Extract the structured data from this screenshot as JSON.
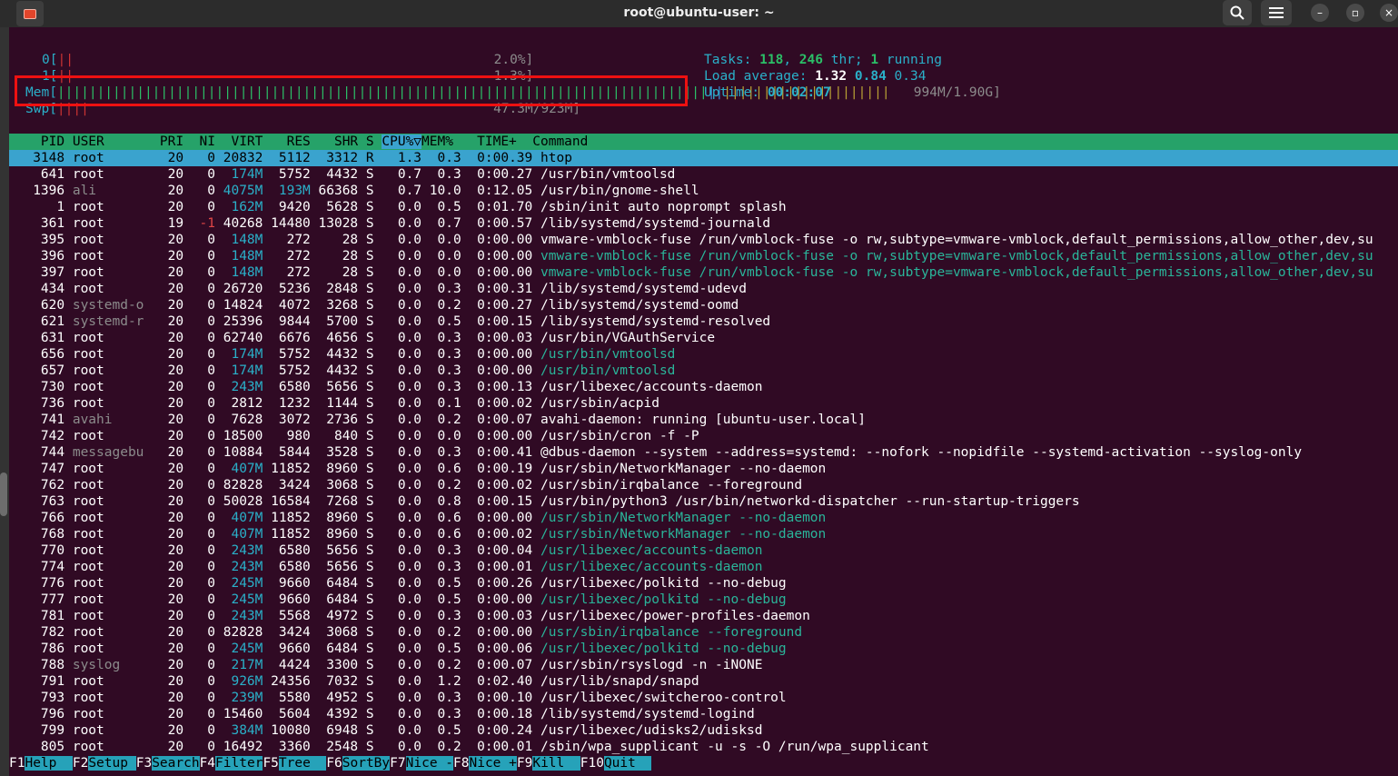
{
  "window": {
    "title": "root@ubuntu-user: ~"
  },
  "meters": {
    "cpu0": {
      "label": "0[",
      "value": "2.0%]"
    },
    "cpu1": {
      "label": "1[",
      "value": "1.3%]"
    },
    "mem": {
      "label": "Mem[",
      "value": "994M/1.90G]"
    },
    "swp": {
      "label": "Swp[",
      "value": "47.3M/923M]"
    }
  },
  "stats": {
    "tasks_label": "Tasks: ",
    "tasks": "118",
    "thr_label": ", ",
    "thr": "246",
    "thr_suffix": " thr; ",
    "running": "1",
    "running_suffix": " running",
    "load_label": "Load average: ",
    "load1": "1.32",
    "load5": "0.84",
    "load15": "0.34",
    "uptime_label": "Uptime: ",
    "uptime": "00:02:07"
  },
  "table": {
    "headers": {
      "pid": "  PID",
      "user": "USER",
      "pri": "PRI",
      "ni": "NI",
      "virt": " VIRT",
      "res": "  RES",
      "shr": "  SHR",
      "s": "S",
      "cpu": "CPU%▽",
      "mem": "MEM%",
      "time": "  TIME+",
      "cmd": "Command"
    },
    "rows": [
      [
        "3148",
        "root",
        "20",
        "0",
        "20832",
        "5112",
        "3312",
        "R",
        "1.3",
        "0.3",
        "0:00.39",
        "htop"
      ],
      [
        "641",
        "root",
        "20",
        "0",
        "174M",
        "5752",
        "4432",
        "S",
        "0.7",
        "0.3",
        "0:00.27",
        "/usr/bin/vmtoolsd"
      ],
      [
        "1396",
        "ali",
        "20",
        "0",
        "4075M",
        "193M",
        "66368",
        "S",
        "0.7",
        "10.0",
        "0:12.05",
        "/usr/bin/gnome-shell"
      ],
      [
        "1",
        "root",
        "20",
        "0",
        "162M",
        "9420",
        "5628",
        "S",
        "0.0",
        "0.5",
        "0:01.70",
        "/sbin/init auto noprompt splash"
      ],
      [
        "361",
        "root",
        "19",
        "-1",
        "40268",
        "14480",
        "13028",
        "S",
        "0.0",
        "0.7",
        "0:00.57",
        "/lib/systemd/systemd-journald"
      ],
      [
        "395",
        "root",
        "20",
        "0",
        "148M",
        "272",
        "28",
        "S",
        "0.0",
        "0.0",
        "0:00.00",
        "vmware-vmblock-fuse /run/vmblock-fuse -o rw,subtype=vmware-vmblock,default_permissions,allow_other,dev,su"
      ],
      [
        "396",
        "root",
        "20",
        "0",
        "148M",
        "272",
        "28",
        "S",
        "0.0",
        "0.0",
        "0:00.00",
        "vmware-vmblock-fuse /run/vmblock-fuse -o rw,subtype=vmware-vmblock,default_permissions,allow_other,dev,su"
      ],
      [
        "397",
        "root",
        "20",
        "0",
        "148M",
        "272",
        "28",
        "S",
        "0.0",
        "0.0",
        "0:00.00",
        "vmware-vmblock-fuse /run/vmblock-fuse -o rw,subtype=vmware-vmblock,default_permissions,allow_other,dev,su"
      ],
      [
        "434",
        "root",
        "20",
        "0",
        "26720",
        "5236",
        "2848",
        "S",
        "0.0",
        "0.3",
        "0:00.31",
        "/lib/systemd/systemd-udevd"
      ],
      [
        "620",
        "systemd-o",
        "20",
        "0",
        "14824",
        "4072",
        "3268",
        "S",
        "0.0",
        "0.2",
        "0:00.27",
        "/lib/systemd/systemd-oomd"
      ],
      [
        "621",
        "systemd-r",
        "20",
        "0",
        "25396",
        "9844",
        "5700",
        "S",
        "0.0",
        "0.5",
        "0:00.15",
        "/lib/systemd/systemd-resolved"
      ],
      [
        "631",
        "root",
        "20",
        "0",
        "62740",
        "6676",
        "4656",
        "S",
        "0.0",
        "0.3",
        "0:00.03",
        "/usr/bin/VGAuthService"
      ],
      [
        "656",
        "root",
        "20",
        "0",
        "174M",
        "5752",
        "4432",
        "S",
        "0.0",
        "0.3",
        "0:00.00",
        "/usr/bin/vmtoolsd"
      ],
      [
        "657",
        "root",
        "20",
        "0",
        "174M",
        "5752",
        "4432",
        "S",
        "0.0",
        "0.3",
        "0:00.00",
        "/usr/bin/vmtoolsd"
      ],
      [
        "730",
        "root",
        "20",
        "0",
        "243M",
        "6580",
        "5656",
        "S",
        "0.0",
        "0.3",
        "0:00.13",
        "/usr/libexec/accounts-daemon"
      ],
      [
        "736",
        "root",
        "20",
        "0",
        "2812",
        "1232",
        "1144",
        "S",
        "0.0",
        "0.1",
        "0:00.02",
        "/usr/sbin/acpid"
      ],
      [
        "741",
        "avahi",
        "20",
        "0",
        "7628",
        "3072",
        "2736",
        "S",
        "0.0",
        "0.2",
        "0:00.07",
        "avahi-daemon: running [ubuntu-user.local]"
      ],
      [
        "742",
        "root",
        "20",
        "0",
        "18500",
        "980",
        "840",
        "S",
        "0.0",
        "0.0",
        "0:00.00",
        "/usr/sbin/cron -f -P"
      ],
      [
        "744",
        "messagebu",
        "20",
        "0",
        "10884",
        "5844",
        "3528",
        "S",
        "0.0",
        "0.3",
        "0:00.41",
        "@dbus-daemon --system --address=systemd: --nofork --nopidfile --systemd-activation --syslog-only"
      ],
      [
        "747",
        "root",
        "20",
        "0",
        "407M",
        "11852",
        "8960",
        "S",
        "0.0",
        "0.6",
        "0:00.19",
        "/usr/sbin/NetworkManager --no-daemon"
      ],
      [
        "762",
        "root",
        "20",
        "0",
        "82828",
        "3424",
        "3068",
        "S",
        "0.0",
        "0.2",
        "0:00.02",
        "/usr/sbin/irqbalance --foreground"
      ],
      [
        "763",
        "root",
        "20",
        "0",
        "50028",
        "16584",
        "7268",
        "S",
        "0.0",
        "0.8",
        "0:00.15",
        "/usr/bin/python3 /usr/bin/networkd-dispatcher --run-startup-triggers"
      ],
      [
        "766",
        "root",
        "20",
        "0",
        "407M",
        "11852",
        "8960",
        "S",
        "0.0",
        "0.6",
        "0:00.00",
        "/usr/sbin/NetworkManager --no-daemon"
      ],
      [
        "768",
        "root",
        "20",
        "0",
        "407M",
        "11852",
        "8960",
        "S",
        "0.0",
        "0.6",
        "0:00.02",
        "/usr/sbin/NetworkManager --no-daemon"
      ],
      [
        "770",
        "root",
        "20",
        "0",
        "243M",
        "6580",
        "5656",
        "S",
        "0.0",
        "0.3",
        "0:00.04",
        "/usr/libexec/accounts-daemon"
      ],
      [
        "774",
        "root",
        "20",
        "0",
        "243M",
        "6580",
        "5656",
        "S",
        "0.0",
        "0.3",
        "0:00.01",
        "/usr/libexec/accounts-daemon"
      ],
      [
        "776",
        "root",
        "20",
        "0",
        "245M",
        "9660",
        "6484",
        "S",
        "0.0",
        "0.5",
        "0:00.26",
        "/usr/libexec/polkitd --no-debug"
      ],
      [
        "777",
        "root",
        "20",
        "0",
        "245M",
        "9660",
        "6484",
        "S",
        "0.0",
        "0.5",
        "0:00.00",
        "/usr/libexec/polkitd --no-debug"
      ],
      [
        "781",
        "root",
        "20",
        "0",
        "243M",
        "5568",
        "4972",
        "S",
        "0.0",
        "0.3",
        "0:00.03",
        "/usr/libexec/power-profiles-daemon"
      ],
      [
        "782",
        "root",
        "20",
        "0",
        "82828",
        "3424",
        "3068",
        "S",
        "0.0",
        "0.2",
        "0:00.00",
        "/usr/sbin/irqbalance --foreground"
      ],
      [
        "786",
        "root",
        "20",
        "0",
        "245M",
        "9660",
        "6484",
        "S",
        "0.0",
        "0.5",
        "0:00.06",
        "/usr/libexec/polkitd --no-debug"
      ],
      [
        "788",
        "syslog",
        "20",
        "0",
        "217M",
        "4424",
        "3300",
        "S",
        "0.0",
        "0.2",
        "0:00.07",
        "/usr/sbin/rsyslogd -n -iNONE"
      ],
      [
        "791",
        "root",
        "20",
        "0",
        "926M",
        "24356",
        "7032",
        "S",
        "0.0",
        "1.2",
        "0:02.40",
        "/usr/lib/snapd/snapd"
      ],
      [
        "793",
        "root",
        "20",
        "0",
        "239M",
        "5580",
        "4952",
        "S",
        "0.0",
        "0.3",
        "0:00.10",
        "/usr/libexec/switcheroo-control"
      ],
      [
        "796",
        "root",
        "20",
        "0",
        "15460",
        "5604",
        "4392",
        "S",
        "0.0",
        "0.3",
        "0:00.18",
        "/lib/systemd/systemd-logind"
      ],
      [
        "799",
        "root",
        "20",
        "0",
        "384M",
        "10080",
        "6948",
        "S",
        "0.0",
        "0.5",
        "0:00.24",
        "/usr/libexec/udisks2/udisksd"
      ],
      [
        "805",
        "root",
        "20",
        "0",
        "16492",
        "3360",
        "2548",
        "S",
        "0.0",
        "0.2",
        "0:00.01",
        "/sbin/wpa_supplicant -u -s -O /run/wpa_supplicant"
      ]
    ],
    "thread_rows": [
      6,
      7,
      12,
      13,
      22,
      23,
      24,
      25,
      27,
      29,
      30
    ]
  },
  "footer": [
    {
      "key": "F1",
      "label": "Help  "
    },
    {
      "key": "F2",
      "label": "Setup "
    },
    {
      "key": "F3",
      "label": "Search"
    },
    {
      "key": "F4",
      "label": "Filter"
    },
    {
      "key": "F5",
      "label": "Tree  "
    },
    {
      "key": "F6",
      "label": "SortBy"
    },
    {
      "key": "F7",
      "label": "Nice -"
    },
    {
      "key": "F8",
      "label": "Nice +"
    },
    {
      "key": "F9",
      "label": "Kill  "
    },
    {
      "key": "F10",
      "label": "Quit  "
    }
  ],
  "colors": {
    "background": "#300a24",
    "header": "#26a269",
    "selection": "#3aa3ce",
    "highlight_box": "#ee1111"
  },
  "icons": [
    "terminal-icon",
    "search-icon",
    "menu-icon",
    "minimize-icon",
    "maximize-icon",
    "close-icon"
  ]
}
